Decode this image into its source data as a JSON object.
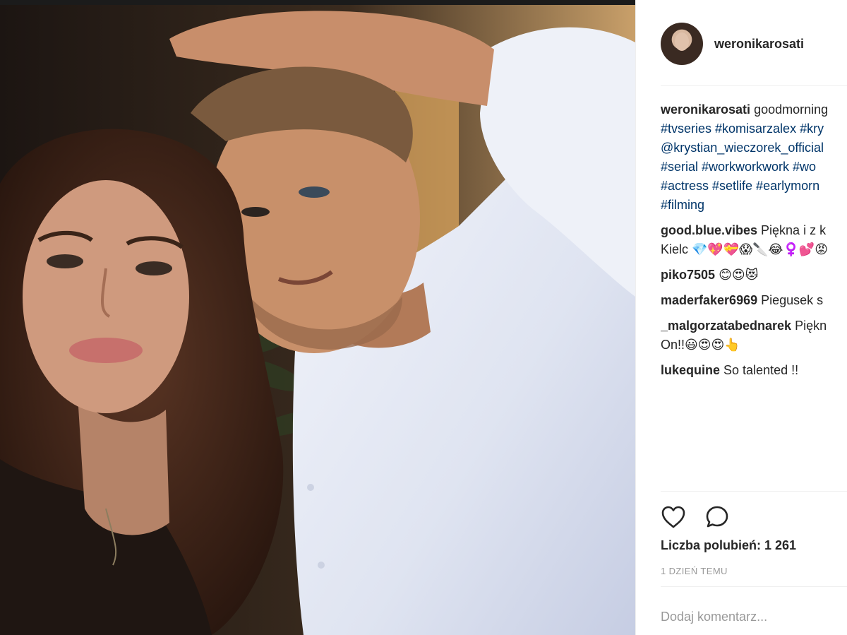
{
  "post": {
    "username": "weronikarosati",
    "caption": {
      "author": "weronikarosati",
      "lines": [
        "goodmorning",
        "#tvseries #komisarzalex #kry",
        "@krystian_wieczorek_official",
        "#serial #workworkwork #wo",
        "#actress #setlife #earlymorn",
        "#filming"
      ]
    },
    "comments": [
      {
        "author": "good.blue.vibes",
        "text": "Piękna i z k",
        "text2": "Kielc 💎💖💝😱🔪😂♀️💕😡"
      },
      {
        "author": "piko7505",
        "text": "😊😍😻"
      },
      {
        "author": "maderfaker6969",
        "text": "Piegusek s"
      },
      {
        "author": "_malgorzatabednarek",
        "text": "Piękn",
        "text2": "On!!😃😍😍👆"
      },
      {
        "author": "lukequine",
        "text": "So talented !!"
      }
    ],
    "likes_label": "Liczba polubień: 1 261",
    "time_label": "1 DZIEŃ TEMU",
    "add_comment_placeholder": "Dodaj komentarz..."
  },
  "icons": {
    "like": "heart-icon",
    "comment": "speech-bubble-icon"
  },
  "colors": {
    "hashtag": "#003569",
    "muted": "#999999",
    "text": "#262626",
    "divider": "#efefef"
  }
}
